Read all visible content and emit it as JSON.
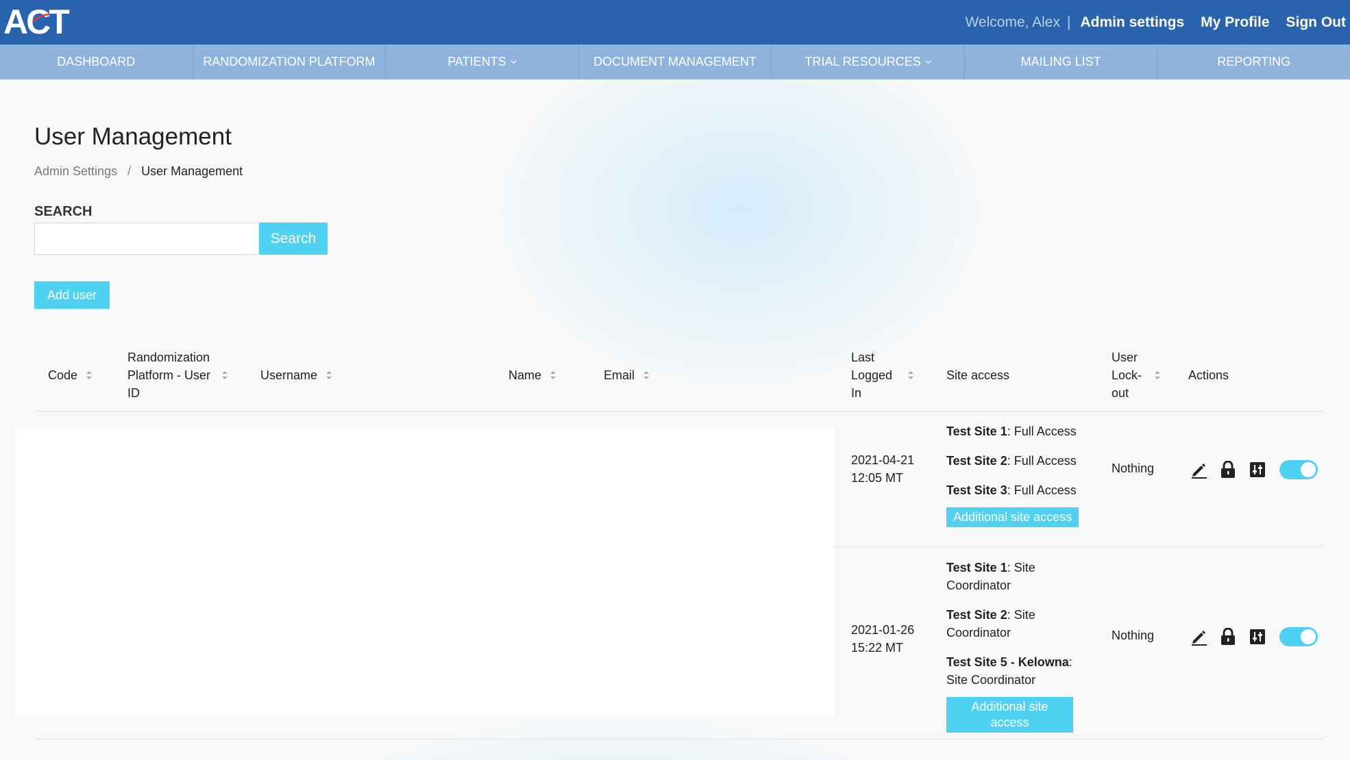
{
  "header": {
    "logo": "ACT",
    "welcome": "Welcome, Alex",
    "separator": "|",
    "links": [
      "Admin settings",
      "My Profile",
      "Sign Out"
    ]
  },
  "nav": {
    "items": [
      {
        "label": "DASHBOARD",
        "dropdown": false
      },
      {
        "label": "RANDOMIZATION PLATFORM",
        "dropdown": false
      },
      {
        "label": "PATIENTS",
        "dropdown": true
      },
      {
        "label": "DOCUMENT MANAGEMENT",
        "dropdown": false
      },
      {
        "label": "TRIAL RESOURCES",
        "dropdown": true
      },
      {
        "label": "MAILING LIST",
        "dropdown": false
      },
      {
        "label": "REPORTING",
        "dropdown": false
      }
    ]
  },
  "page": {
    "title": "User Management",
    "breadcrumb": {
      "parent": "Admin Settings",
      "separator": "/",
      "current": "User Management"
    }
  },
  "search": {
    "label": "SEARCH",
    "value": "",
    "placeholder": "",
    "button": "Search"
  },
  "add_user_label": "Add user",
  "table": {
    "columns": [
      {
        "key": "code",
        "label": "Code",
        "sortable": true
      },
      {
        "key": "rp_id",
        "label": "Randomization Platform - User ID",
        "sortable": true
      },
      {
        "key": "username",
        "label": "Username",
        "sortable": true
      },
      {
        "key": "name",
        "label": "Name",
        "sortable": true
      },
      {
        "key": "email",
        "label": "Email",
        "sortable": true
      },
      {
        "key": "last_logged_in",
        "label": "Last Logged In",
        "sortable": true
      },
      {
        "key": "site_access",
        "label": "Site access",
        "sortable": false
      },
      {
        "key": "lockout",
        "label": "User Lock-out",
        "sortable": true
      },
      {
        "key": "actions",
        "label": "Actions",
        "sortable": false
      }
    ],
    "rows": [
      {
        "last_logged_in": [
          "2021-04-21",
          "12:05 MT"
        ],
        "site_access": [
          {
            "site": "Test Site 1",
            "role": "Full Access"
          },
          {
            "site": "Test Site 2",
            "role": "Full Access"
          },
          {
            "site": "Test Site 3",
            "role": "Full Access"
          }
        ],
        "additional_label": "Additional site access",
        "lockout": "Nothing",
        "active": true
      },
      {
        "last_logged_in": [
          "2021-01-26",
          "15:22 MT"
        ],
        "site_access": [
          {
            "site": "Test Site 1",
            "role": "Site Coordinator"
          },
          {
            "site": "Test Site 2",
            "role": "Site Coordinator"
          },
          {
            "site": "Test Site 5 - Kelowna",
            "role": "Site Coordinator"
          }
        ],
        "additional_label": "Additional site access",
        "lockout": "Nothing",
        "active": true
      }
    ]
  },
  "colors": {
    "header": "#2a63ad",
    "nav": "#8fb3dc",
    "accent": "#4fd1f2"
  },
  "icons": [
    "edit-icon",
    "lock-icon",
    "settings-sliders-icon",
    "active-toggle",
    "sort-icon",
    "chevron-down-icon"
  ]
}
